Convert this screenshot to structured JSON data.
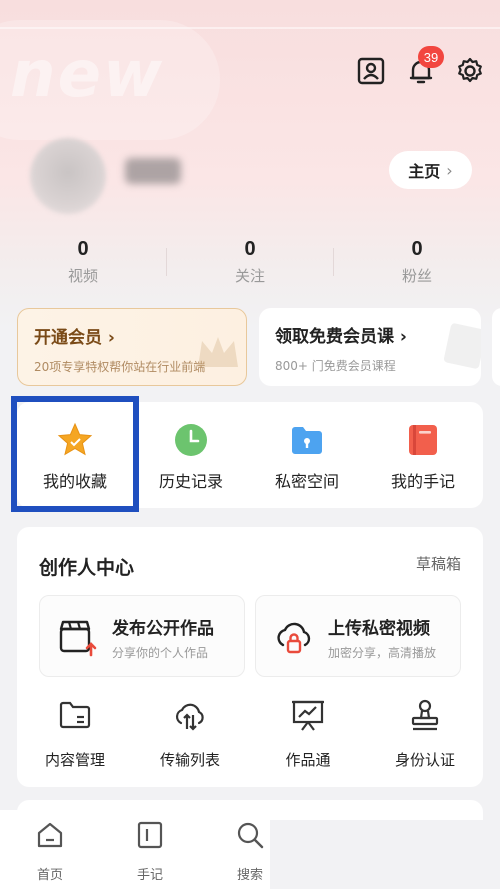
{
  "header": {
    "notification_count": "39",
    "home_button_label": "主页",
    "home_button_chevron": "›"
  },
  "stats": [
    {
      "value": "0",
      "label": "视频"
    },
    {
      "value": "0",
      "label": "关注"
    },
    {
      "value": "0",
      "label": "粉丝"
    }
  ],
  "promos": {
    "vip": {
      "title": "开通会员 ›",
      "subtitle": "20项专享特权帮你站在行业前端"
    },
    "course": {
      "title": "领取免费会员课 ›",
      "subtitle": "800+ 门免费会员课程"
    }
  },
  "quick_access": [
    {
      "label": "我的收藏",
      "icon": "star-icon"
    },
    {
      "label": "历史记录",
      "icon": "clock-icon"
    },
    {
      "label": "私密空间",
      "icon": "private-folder-icon"
    },
    {
      "label": "我的手记",
      "icon": "notebook-icon"
    }
  ],
  "creator": {
    "title": "创作人中心",
    "drafts_label": "草稿箱",
    "publish": {
      "title": "发布公开作品",
      "subtitle": "分享你的个人作品"
    },
    "upload": {
      "title": "上传私密视频",
      "subtitle": "加密分享，高清播放"
    },
    "tools": [
      {
        "label": "内容管理",
        "icon": "folder-manage-icon"
      },
      {
        "label": "传输列表",
        "icon": "cloud-transfer-icon"
      },
      {
        "label": "作品通",
        "icon": "presentation-icon"
      },
      {
        "label": "身份认证",
        "icon": "stamp-icon"
      }
    ]
  },
  "tabbar": [
    {
      "label": "首页",
      "icon": "home-icon"
    },
    {
      "label": "手记",
      "icon": "notes-icon"
    },
    {
      "label": "搜索",
      "icon": "search-icon"
    }
  ],
  "colors": {
    "accent_red": "#f2463f",
    "highlight_blue": "#1f4fbf",
    "vip_gold": "#7a4a17"
  }
}
